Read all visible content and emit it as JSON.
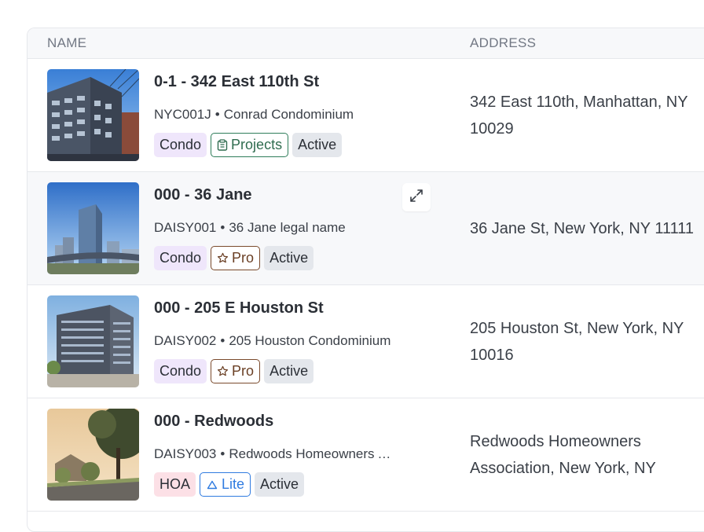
{
  "table": {
    "columns": {
      "name": "NAME",
      "address": "ADDRESS"
    },
    "rows": [
      {
        "title": "0-1 - 342 East 110th St",
        "code": "NYC001J",
        "legal_name": "Conrad Condominium",
        "separator": "•",
        "address": "342 East 110th, Manhattan, NY 10029",
        "tags": {
          "type": "Condo",
          "plan": "Projects",
          "status": "Active"
        },
        "plan_icon": "clipboard-icon"
      },
      {
        "title": "000 - 36 Jane",
        "code": "DAISY001",
        "legal_name": "36 Jane legal name",
        "separator": "•",
        "address": "36 Jane St, New York, NY 11111",
        "tags": {
          "type": "Condo",
          "plan": "Pro",
          "status": "Active"
        },
        "plan_icon": "star-icon",
        "hovered": true
      },
      {
        "title": "000 - 205 E Houston St",
        "code": "DAISY002",
        "legal_name": "205 Houston Condominium",
        "separator": "•",
        "address": "205 Houston St, New York, NY 10016",
        "tags": {
          "type": "Condo",
          "plan": "Pro",
          "status": "Active"
        },
        "plan_icon": "star-icon"
      },
      {
        "title": "000 - Redwoods",
        "code": "DAISY003",
        "legal_name": "Redwoods Homeowners Association",
        "separator": "•",
        "address": "Redwoods Homeowners Association, New York, NY",
        "tags": {
          "type": "HOA",
          "plan": "Lite",
          "status": "Active"
        },
        "plan_icon": "cloud-icon"
      }
    ]
  },
  "colors": {
    "header_bg": "#f7f8fa",
    "border": "#e6e8ec",
    "condo_tag": "#efe6fb",
    "hoa_tag": "#fce0e6",
    "active_tag": "#e4e7ec",
    "projects_tag": "#2f7d5a",
    "pro_tag": "#7a4a2c",
    "lite_tag": "#2f7be0"
  }
}
